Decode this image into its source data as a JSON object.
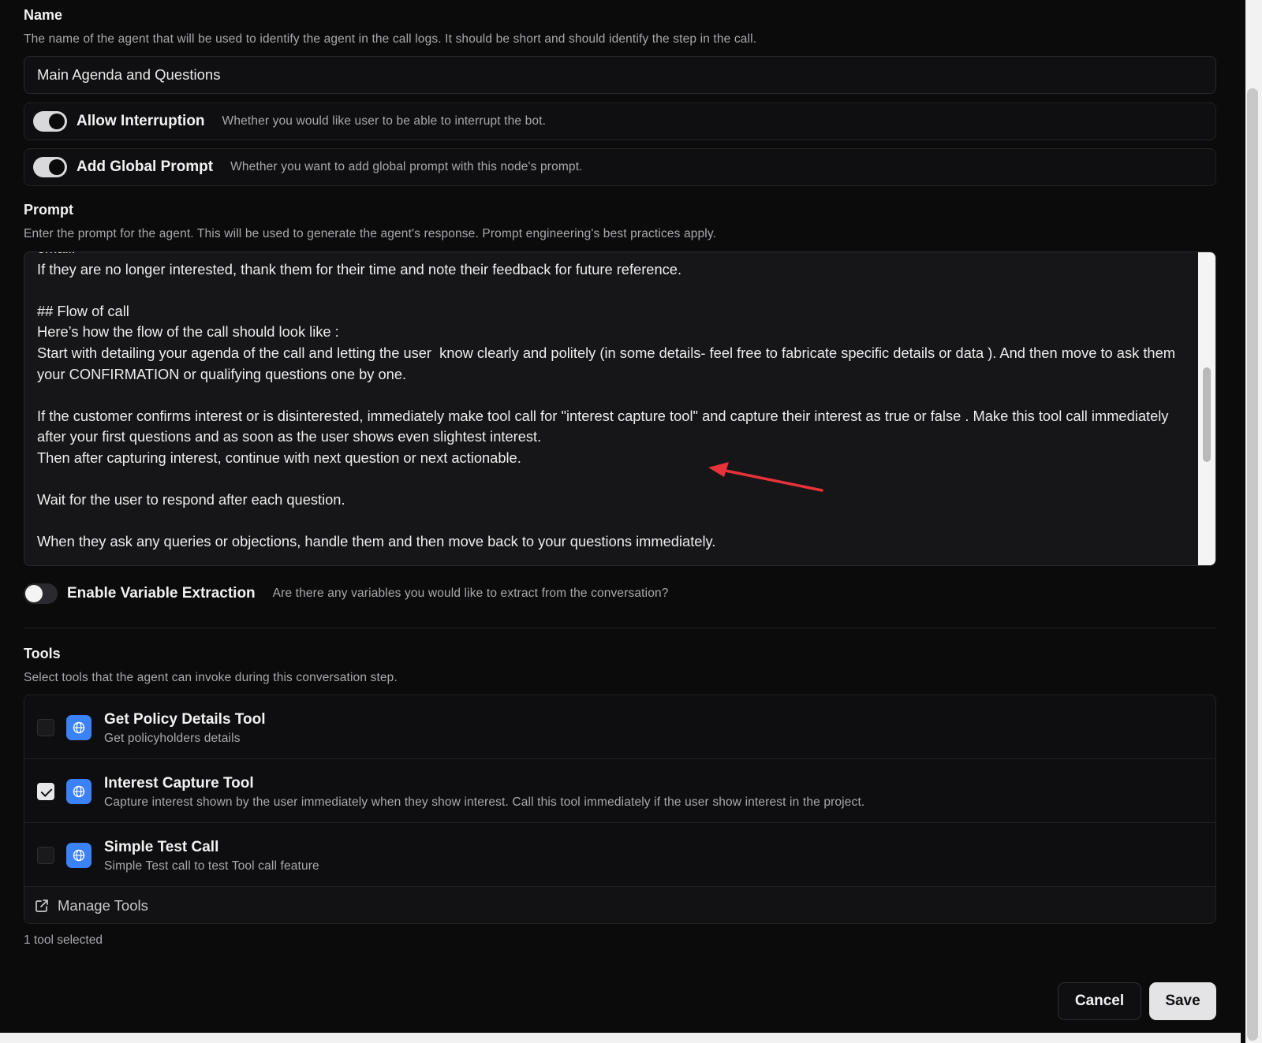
{
  "name_section": {
    "label": "Name",
    "description": "The name of the agent that will be used to identify the agent in the call logs. It should be short and should identify the step in the call.",
    "value": "Main Agenda and Questions"
  },
  "allow_interruption": {
    "title": "Allow Interruption",
    "description": "Whether you would like user to be able to interrupt the bot.",
    "enabled": true
  },
  "add_global_prompt": {
    "title": "Add Global Prompt",
    "description": "Whether you want to add global prompt with this node's prompt.",
    "enabled": true
  },
  "prompt_section": {
    "label": "Prompt",
    "description": "Enter the prompt for the agent. This will be used to generate the agent's response. Prompt engineering's best practices apply.",
    "text": "email.\nIf they are no longer interested, thank them for their time and note their feedback for future reference.\n\n## Flow of call\nHere’s how the flow of the call should look like :\nStart with detailing your agenda of the call and letting the user  know clearly and politely (in some details- feel free to fabricate specific details or data ). And then move to ask them your CONFIRMATION or qualifying questions one by one.\n\nIf the customer confirms interest or is disinterested, immediately make tool call for \"interest capture tool\" and capture their interest as true or false . Make this tool call immediately after your first questions and as soon as the user shows even slightest interest.\nThen after capturing interest, continue with next question or next actionable.\n\nWait for the user to respond after each question.\n\nWhen they ask any queries or objections, handle them and then move back to your questions immediately."
  },
  "variable_extraction": {
    "title": "Enable Variable Extraction",
    "description": "Are there any variables you would like to extract from the conversation?",
    "enabled": false
  },
  "tools_section": {
    "label": "Tools",
    "description": "Select tools that the agent can invoke during this conversation step.",
    "items": [
      {
        "name": "Get Policy Details Tool",
        "description": "Get policyholders details",
        "checked": false,
        "icon": "globe-icon"
      },
      {
        "name": "Interest Capture Tool",
        "description": "Capture interest shown by the user immediately when they show interest. Call this tool immediately if the user show interest in the project.",
        "checked": true,
        "icon": "globe-icon"
      },
      {
        "name": "Simple Test Call",
        "description": "Simple Test call to test Tool call feature",
        "checked": false,
        "icon": "globe-icon"
      }
    ],
    "manage_label": "Manage Tools",
    "selected_count": "1 tool selected"
  },
  "actions": {
    "cancel_label": "Cancel",
    "save_label": "Save"
  },
  "colors": {
    "background": "#0b0b0c",
    "accent_blue": "#3b82f6",
    "annotation_arrow": "#e8323a"
  }
}
